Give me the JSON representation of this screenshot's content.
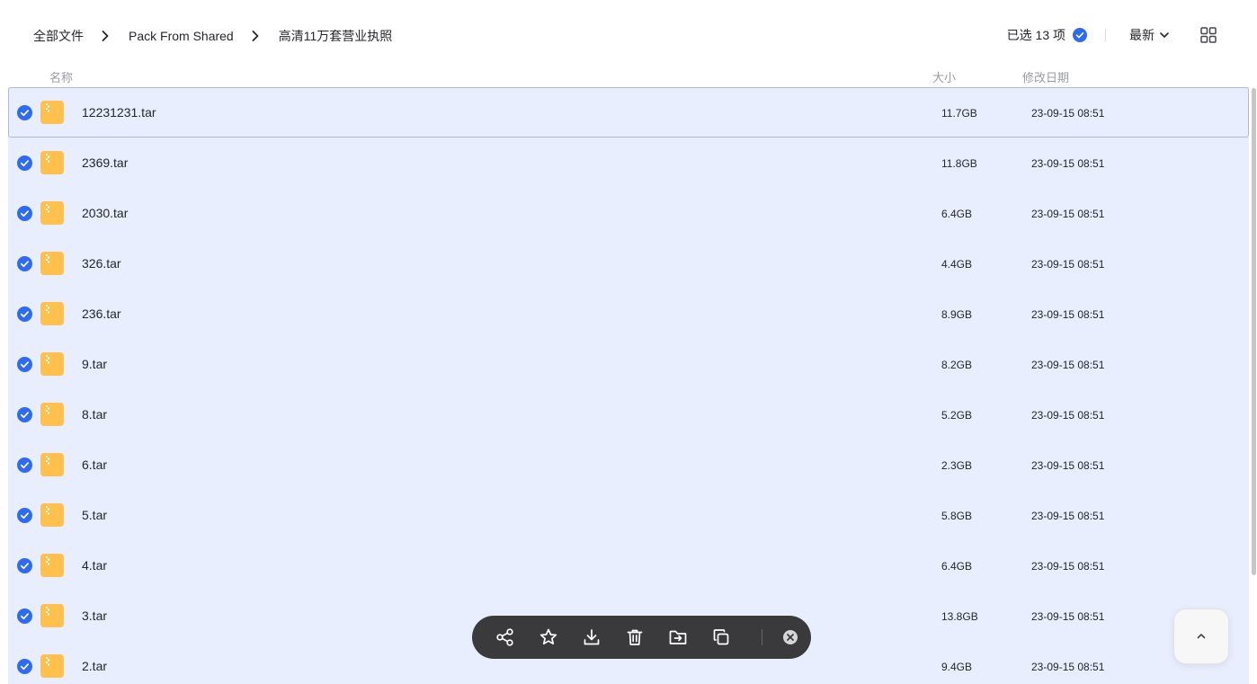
{
  "breadcrumb": {
    "items": [
      "全部文件",
      "Pack From Shared",
      "高清11万套营业执照"
    ]
  },
  "toolbar": {
    "selected_label": "已选 13 项",
    "sort_label": "最新"
  },
  "columns": {
    "name": "名称",
    "size": "大小",
    "date": "修改日期"
  },
  "files": [
    {
      "name": "12231231.tar",
      "size": "11.7GB",
      "date": "23-09-15 08:51"
    },
    {
      "name": "2369.tar",
      "size": "11.8GB",
      "date": "23-09-15 08:51"
    },
    {
      "name": "2030.tar",
      "size": "6.4GB",
      "date": "23-09-15 08:51"
    },
    {
      "name": "326.tar",
      "size": "4.4GB",
      "date": "23-09-15 08:51"
    },
    {
      "name": "236.tar",
      "size": "8.9GB",
      "date": "23-09-15 08:51"
    },
    {
      "name": "9.tar",
      "size": "8.2GB",
      "date": "23-09-15 08:51"
    },
    {
      "name": "8.tar",
      "size": "5.2GB",
      "date": "23-09-15 08:51"
    },
    {
      "name": "6.tar",
      "size": "2.3GB",
      "date": "23-09-15 08:51"
    },
    {
      "name": "5.tar",
      "size": "5.8GB",
      "date": "23-09-15 08:51"
    },
    {
      "name": "4.tar",
      "size": "6.4GB",
      "date": "23-09-15 08:51"
    },
    {
      "name": "3.tar",
      "size": "13.8GB",
      "date": "23-09-15 08:51"
    },
    {
      "name": "2.tar",
      "size": "9.4GB",
      "date": "23-09-15 08:51"
    }
  ],
  "actions": [
    "share-icon",
    "star-icon",
    "download-icon",
    "trash-icon",
    "move-icon",
    "copy-icon"
  ],
  "colors": {
    "accent": "#2f6bf0",
    "selection_bg": "#e8eefd",
    "archive_icon": "#ffc04d",
    "action_bar_bg": "#3a3a3c"
  }
}
